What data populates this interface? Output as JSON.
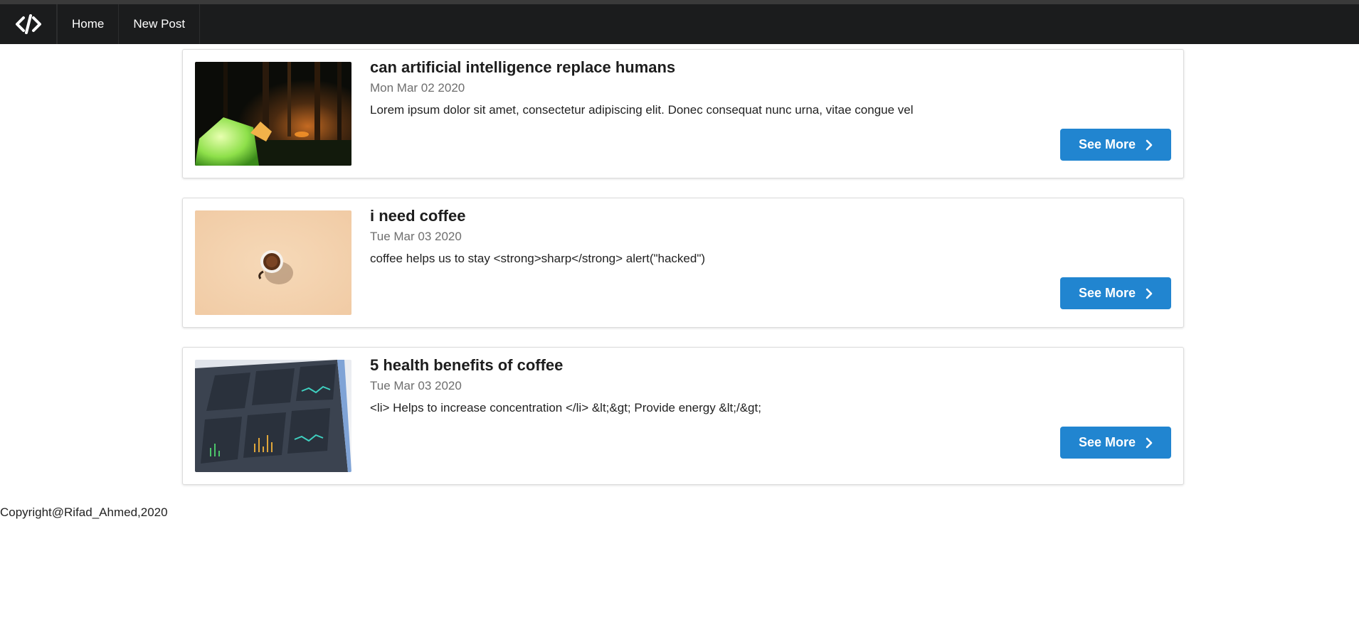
{
  "nav": {
    "logo_icon": "code-icon",
    "items": [
      {
        "label": "Home"
      },
      {
        "label": "New Post"
      }
    ]
  },
  "posts": [
    {
      "title": "can artificial intelligence replace humans",
      "date": "Mon Mar 02 2020",
      "description": "Lorem ipsum dolor sit amet, consectetur adipiscing elit. Donec consequat nunc urna, vitae congue vel",
      "image": "camping-tents-forest-night",
      "button_label": "See More"
    },
    {
      "title": "i need coffee",
      "date": "Tue Mar 03 2020",
      "description": "coffee helps us to stay <strong>sharp</strong> alert(\"hacked\")",
      "image": "coffee-cup-beige-background",
      "button_label": "See More"
    },
    {
      "title": "5 health benefits of coffee",
      "date": "Tue Mar 03 2020",
      "description": "<li> Helps to increase concentration </li> &lt;&gt; Provide energy &lt;/&gt;",
      "image": "analytics-dashboard-screen",
      "button_label": "See More"
    }
  ],
  "footer": {
    "copyright": "Copyright@Rifad_Ahmed,2020"
  },
  "colors": {
    "navbar_bg": "#1b1c1d",
    "button_blue": "#2185d0"
  }
}
